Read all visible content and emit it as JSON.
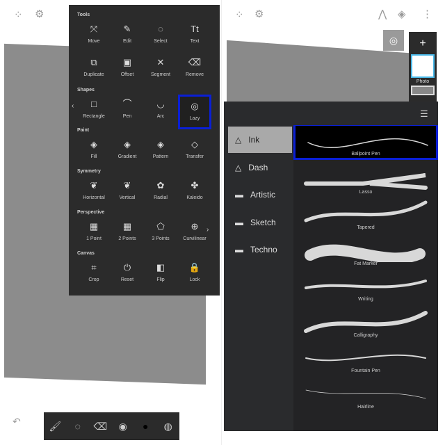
{
  "left": {
    "top_icons": [
      "collapse-icon",
      "settings-icon"
    ],
    "menu": {
      "sections": [
        {
          "title": "Tools",
          "items": [
            {
              "label": "Move",
              "icon": "⤧"
            },
            {
              "label": "Edit",
              "icon": "✎"
            },
            {
              "label": "Select",
              "icon": "◌"
            },
            {
              "label": "Text",
              "icon": "Tt"
            },
            {
              "label": "Duplicate",
              "icon": "⧉"
            },
            {
              "label": "Offset",
              "icon": "▣"
            },
            {
              "label": "Segment",
              "icon": "✕"
            },
            {
              "label": "Remove",
              "icon": "⌫"
            }
          ]
        },
        {
          "title": "Shapes",
          "items": [
            {
              "label": "Rectangle",
              "icon": "□"
            },
            {
              "label": "Pen",
              "icon": "⌒"
            },
            {
              "label": "Arc",
              "icon": "◡"
            },
            {
              "label": "Lazy",
              "icon": "◎",
              "selected": true
            }
          ]
        },
        {
          "title": "Paint",
          "items": [
            {
              "label": "Fill",
              "icon": "◈"
            },
            {
              "label": "Gradient",
              "icon": "◈"
            },
            {
              "label": "Pattern",
              "icon": "◈"
            },
            {
              "label": "Transfer",
              "icon": "◇"
            }
          ]
        },
        {
          "title": "Symmetry",
          "items": [
            {
              "label": "Horizontal",
              "icon": "❦"
            },
            {
              "label": "Vertical",
              "icon": "❦"
            },
            {
              "label": "Radial",
              "icon": "✿"
            },
            {
              "label": "Kaleido",
              "icon": "✤"
            }
          ]
        },
        {
          "title": "Perspective",
          "items": [
            {
              "label": "1 Point",
              "icon": "▦"
            },
            {
              "label": "2 Points",
              "icon": "▦"
            },
            {
              "label": "3 Points",
              "icon": "⬠"
            },
            {
              "label": "Curvilinear",
              "icon": "⊕"
            }
          ]
        },
        {
          "title": "Canvas",
          "items": [
            {
              "label": "Crop",
              "icon": "⌗"
            },
            {
              "label": "Reset",
              "icon": "⏻"
            },
            {
              "label": "Flip",
              "icon": "◧"
            },
            {
              "label": "Lock",
              "icon": "🔒"
            }
          ]
        }
      ],
      "prev": "‹",
      "next": "›"
    },
    "bottom_toolbar": [
      {
        "name": "brush",
        "icon": "🖌"
      },
      {
        "name": "lasso",
        "icon": "◌"
      },
      {
        "name": "eraser",
        "icon": "⌫"
      },
      {
        "name": "brush-size",
        "icon": "◉"
      },
      {
        "name": "color",
        "icon": "●"
      },
      {
        "name": "opacity",
        "icon": "◍"
      }
    ],
    "undo_icon": "↶"
  },
  "right": {
    "top_icons": [
      "collapse-icon",
      "settings-icon",
      "ruler-icon",
      "layers-icon",
      "more-icon"
    ],
    "layers": {
      "add": "+",
      "label": "Photo"
    },
    "categories": [
      {
        "label": "Ink",
        "icon": "△",
        "active": true
      },
      {
        "label": "Dash",
        "icon": "△"
      },
      {
        "label": "Artistic",
        "icon": "▬"
      },
      {
        "label": "Sketch",
        "icon": "▬"
      },
      {
        "label": "Techno",
        "icon": "▬"
      }
    ],
    "brushes": [
      "Ballpoint Pen",
      "Lasso",
      "Tapered",
      "Fat Marker",
      "Writing",
      "Calligraphy",
      "Fountain Pen",
      "Hairline"
    ],
    "selected_brush": "Ballpoint Pen",
    "highlight_color": "#0a1fd6"
  }
}
